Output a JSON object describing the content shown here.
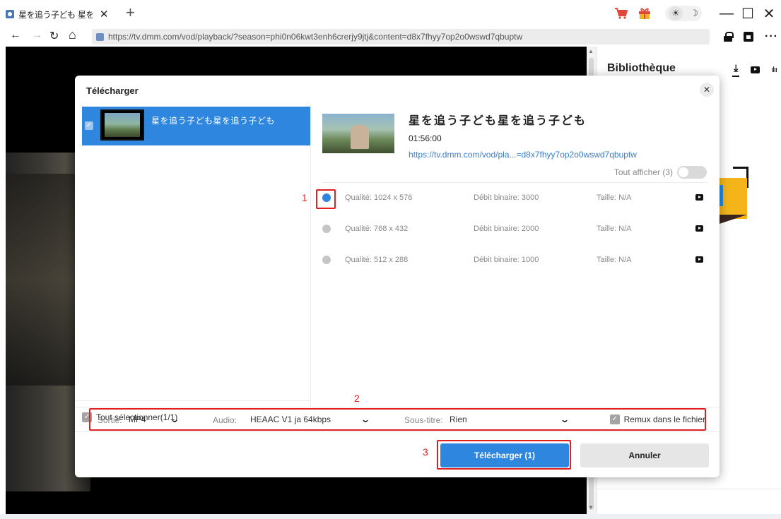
{
  "browser": {
    "tab_title": "星を追う子ども 星を",
    "tab_close": "✕",
    "new_tab": "+",
    "url": "https://tv.dmm.com/vod/playback/?season=phi0n06kwt3enh6crerjy9jtj&content=d8x7fhyy7op2o0wswd7qbuptw",
    "theme_sun": "☀",
    "theme_moon": "☽",
    "window_controls": [
      "—",
      "☐",
      "✕"
    ],
    "nav": {
      "back": "←",
      "forward": "→",
      "reload": "↻",
      "home": "⌂"
    },
    "more": "···"
  },
  "library": {
    "title": "Bibliothèque",
    "tabs": [
      "⤓",
      "youtube-icon",
      "ılıı"
    ]
  },
  "dialog": {
    "title": "Télécharger",
    "close": "✕",
    "left_item": {
      "title": "星を追う子ども星を追う子ども",
      "checked": true
    },
    "select_all": "Tout sélectionner(1/1)",
    "video": {
      "title": "星を追う子ども星を追う子ども",
      "duration": "01:56:00",
      "url": "https://tv.dmm.com/vod/pla...=d8x7fhyy7op2o0wswd7qbuptw"
    },
    "show_all": "Tout afficher (3)",
    "qualities": [
      {
        "quality": "Qualité: 1024 x 576",
        "bitrate": "Débit binaire: 3000",
        "size": "Taille: N/A",
        "selected": true
      },
      {
        "quality": "Qualité: 768 x 432",
        "bitrate": "Débit binaire: 2000",
        "size": "Taille: N/A",
        "selected": false
      },
      {
        "quality": "Qualité: 512 x 288",
        "bitrate": "Débit binaire: 1000",
        "size": "Taille: N/A",
        "selected": false
      }
    ],
    "options": {
      "output_label": "Sortie:",
      "output_value": "MP4",
      "audio_label": "Audio:",
      "audio_value": "HEAAC V1 ja 64kbps",
      "subtitle_label": "Sous-titre:",
      "subtitle_value": "Rien",
      "remux_label": "Remux dans le fichier",
      "remux_checked": true
    },
    "download_button": "Télécharger (1)",
    "cancel_button": "Annuler"
  },
  "annotations": [
    "1",
    "2",
    "3"
  ],
  "colors": {
    "accent": "#2e86de",
    "annotation": "#e02020"
  }
}
